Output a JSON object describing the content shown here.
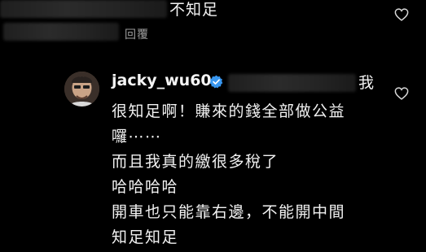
{
  "top_comment": {
    "text": "不知足",
    "reply_label": "回覆"
  },
  "reply_comment": {
    "username": "jacky_wu60",
    "first_line_tail": "我",
    "lines": [
      "很知足啊！賺來的錢全部做公益",
      "囉⋯⋯",
      "而且我真的繳很多稅了",
      "哈哈哈哈",
      "開車也只能靠右邊，不能開中間",
      "知足知足"
    ]
  },
  "icons": {
    "like": "heart-outline-icon",
    "verified": "verified-badge-icon"
  },
  "colors": {
    "background": "#000000",
    "verified_blue": "#3897f0",
    "secondary_text": "#9b9b9b"
  }
}
